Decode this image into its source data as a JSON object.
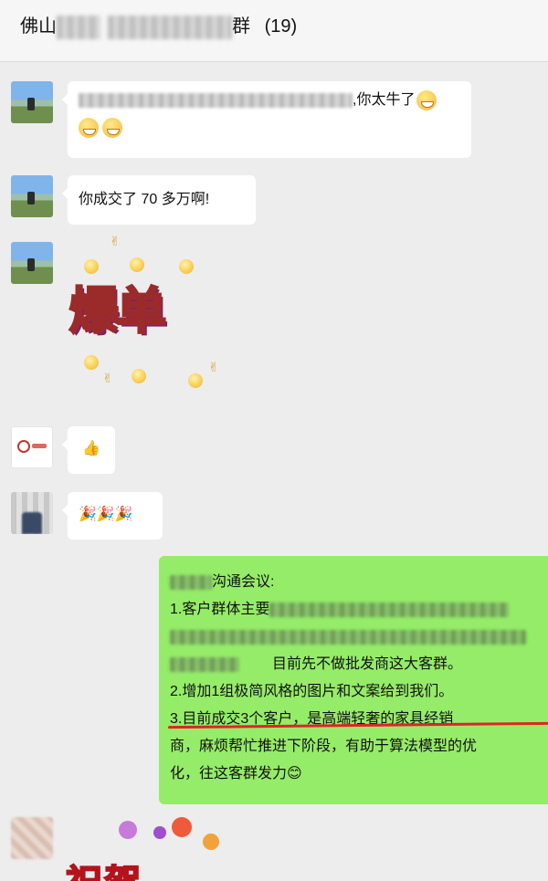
{
  "header": {
    "title_prefix": "佛山",
    "title_suffix": "群",
    "member_count": "(19)"
  },
  "messages": [
    {
      "sender": "user-1",
      "text_suffix": ",你太牛了"
    },
    {
      "sender": "user-1",
      "text": "你成交了 70 多万啊!"
    },
    {
      "sender": "user-1",
      "sticker_text": "爆单"
    },
    {
      "sender": "user-2",
      "emoji": "👍"
    },
    {
      "sender": "user-3",
      "emoji": "🎉🎉🎉"
    },
    {
      "sender": "me",
      "lines": [
        "沟通会议:",
        "1.客户群体主要",
        "",
        "目前先不做批发商这大客群。",
        "2.增加1组极简风格的图片和文案给到我们。",
        "3.目前成交3个客户，是高端轻奢的家具经销",
        "商，麻烦帮忙推进下阶段，有助于算法模型的优",
        "化，往这客群发力😊"
      ]
    },
    {
      "sender": "user-4",
      "sticker_text": "祝贺"
    }
  ]
}
